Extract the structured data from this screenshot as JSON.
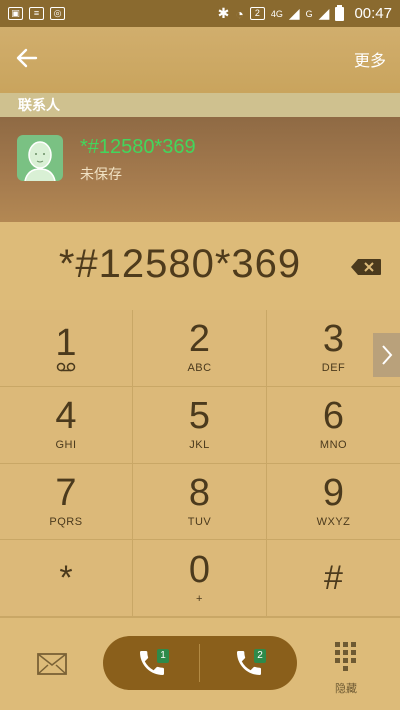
{
  "statusbar": {
    "sim_badge": "2",
    "network_4g": "4G",
    "network_g": "G",
    "time": "00:47"
  },
  "header": {
    "more_label": "更多"
  },
  "contacts": {
    "section_label": "联系人",
    "number": "*#12580*369",
    "subtitle": "未保存"
  },
  "dialer": {
    "entered_number": "*#12580*369"
  },
  "keypad": [
    {
      "digit": "1",
      "letters": ""
    },
    {
      "digit": "2",
      "letters": "ABC"
    },
    {
      "digit": "3",
      "letters": "DEF"
    },
    {
      "digit": "4",
      "letters": "GHI"
    },
    {
      "digit": "5",
      "letters": "JKL"
    },
    {
      "digit": "6",
      "letters": "MNO"
    },
    {
      "digit": "7",
      "letters": "PQRS"
    },
    {
      "digit": "8",
      "letters": "TUV"
    },
    {
      "digit": "9",
      "letters": "WXYZ"
    },
    {
      "digit": "*",
      "letters": ""
    },
    {
      "digit": "0",
      "letters": "+"
    },
    {
      "digit": "#",
      "letters": ""
    }
  ],
  "bottom": {
    "sim1_badge": "1",
    "sim2_badge": "2",
    "hide_label": "隐藏"
  },
  "colors": {
    "background": "#dcb979",
    "accent_green": "#43d65c",
    "call_pill": "#8a5f1b"
  }
}
